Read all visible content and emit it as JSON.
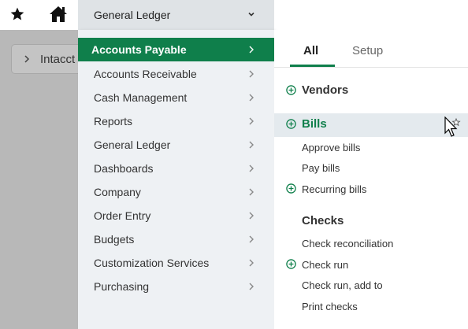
{
  "topbar": {
    "dropdown_label": "General Ledger"
  },
  "background": {
    "breadcrumb_label": "Intacct"
  },
  "menu": {
    "items": [
      {
        "label": "Accounts Payable",
        "active": true
      },
      {
        "label": "Accounts Receivable"
      },
      {
        "label": "Cash Management"
      },
      {
        "label": "Reports"
      },
      {
        "label": "General Ledger"
      },
      {
        "label": "Dashboards"
      },
      {
        "label": "Company"
      },
      {
        "label": "Order Entry"
      },
      {
        "label": "Budgets"
      },
      {
        "label": "Customization Services"
      },
      {
        "label": "Purchasing"
      }
    ]
  },
  "panel": {
    "tabs": [
      {
        "label": "All",
        "active": true
      },
      {
        "label": "Setup"
      }
    ],
    "vendors_label": "Vendors",
    "bills_label": "Bills",
    "bills_links": [
      "Approve bills",
      "Pay bills",
      "Recurring bills"
    ],
    "checks_label": "Checks",
    "checks_links": [
      "Check reconciliation",
      "Check run",
      "Check run, add to",
      "Print checks"
    ]
  },
  "colors": {
    "accent": "#0f7f4b",
    "menu_bg": "#eef1f4",
    "dropdown_bg": "#dfe3e6",
    "overlay_gray": "#b8b8b8"
  }
}
